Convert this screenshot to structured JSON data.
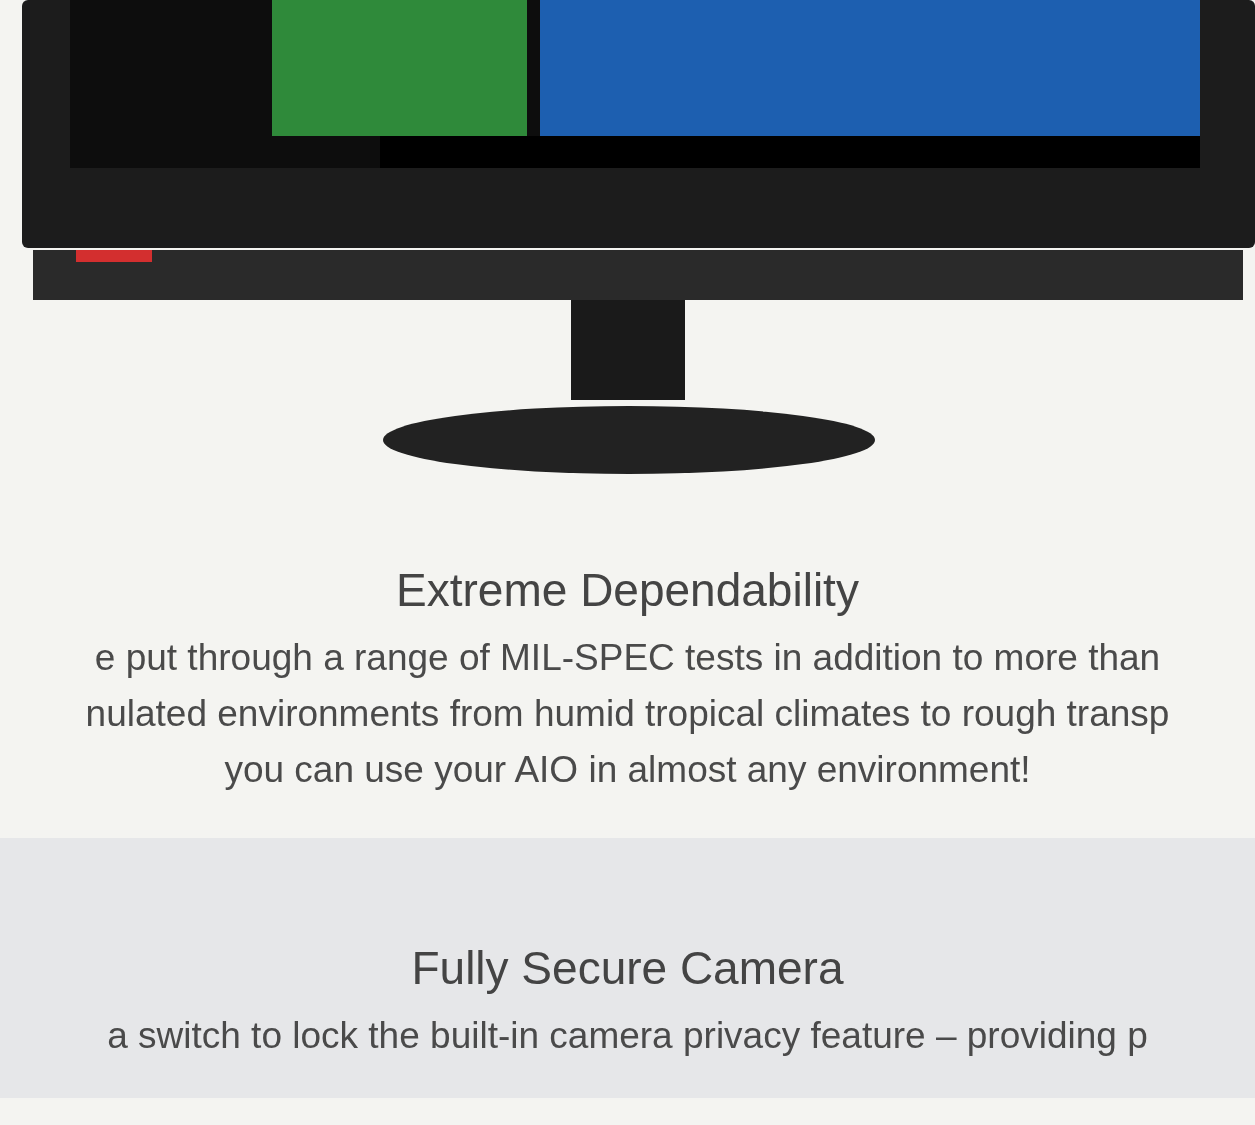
{
  "sections": [
    {
      "heading": "Extreme Dependability",
      "lines": [
        "e put through a range of MIL-SPEC tests in addition to more than",
        "nulated environments from humid tropical climates to rough transp",
        "you can use your AIO in almost any environment!"
      ]
    },
    {
      "heading": "Fully Secure Camera",
      "lines": [
        "a switch to lock the built-in camera privacy feature – providing p"
      ]
    }
  ]
}
